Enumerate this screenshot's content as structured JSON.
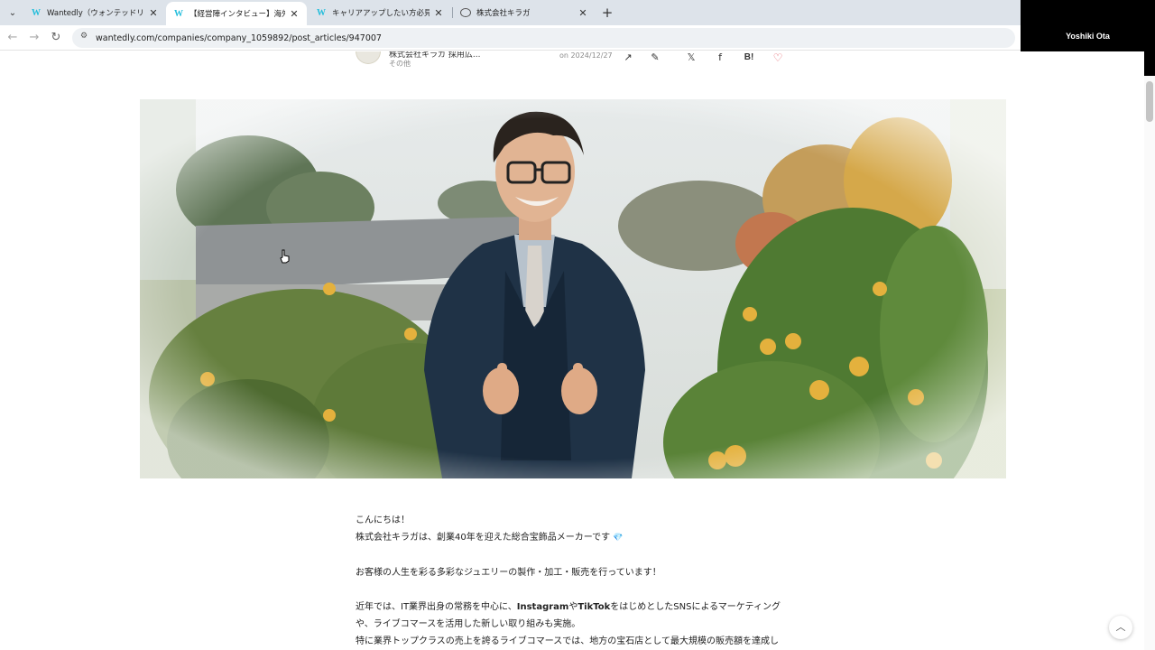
{
  "browser": {
    "tabs": [
      {
        "title": "Wantedly（ウォンテッドリー）はた",
        "favicon": "W",
        "active": false
      },
      {
        "title": "【経営陣インタビュー】海外赴任も経",
        "favicon": "W",
        "active": true
      },
      {
        "title": "キャリアアップしたい方必見！ジュエ",
        "favicon": "W",
        "active": false
      },
      {
        "title": "株式会社キラガ",
        "favicon": "globe-icon",
        "active": false
      }
    ],
    "new_tab": "+",
    "url": "wantedly.com/companies/company_1059892/post_articles/947007"
  },
  "overlay": {
    "participant_name": "Yoshiki Ota"
  },
  "post_header": {
    "author": "株式会社キラガ 採用広...",
    "category": "その他",
    "date": "on 2024/12/27",
    "actions": {
      "trend": "↗",
      "edit": "✎",
      "x": "𝕏",
      "facebook": "f",
      "hatena": "B!",
      "like": "♡"
    }
  },
  "article": {
    "line1": "こんにちは！",
    "line2": "株式会社キラガは、創業40年を迎えた総合宝飾品メーカーです",
    "line2_emoji": "💎",
    "line3": "お客様の人生を彩る多彩なジュエリーの製作・加工・販売を行っています！",
    "line4_a": "近年では、IT業界出身の常務を中心に、",
    "line4_b": "Instagram",
    "line4_c": "や",
    "line4_d": "TikTok",
    "line4_e": "をはじめとしたSNSによるマーケティング",
    "line5": "や、ライブコマースを活用した新しい取り組みも実施。",
    "line6": "特に業界トップクラスの売上を誇るライブコマースでは、地方の宝石店として最大規模の販売額を達成し"
  },
  "scroll_top_icon": "︿"
}
